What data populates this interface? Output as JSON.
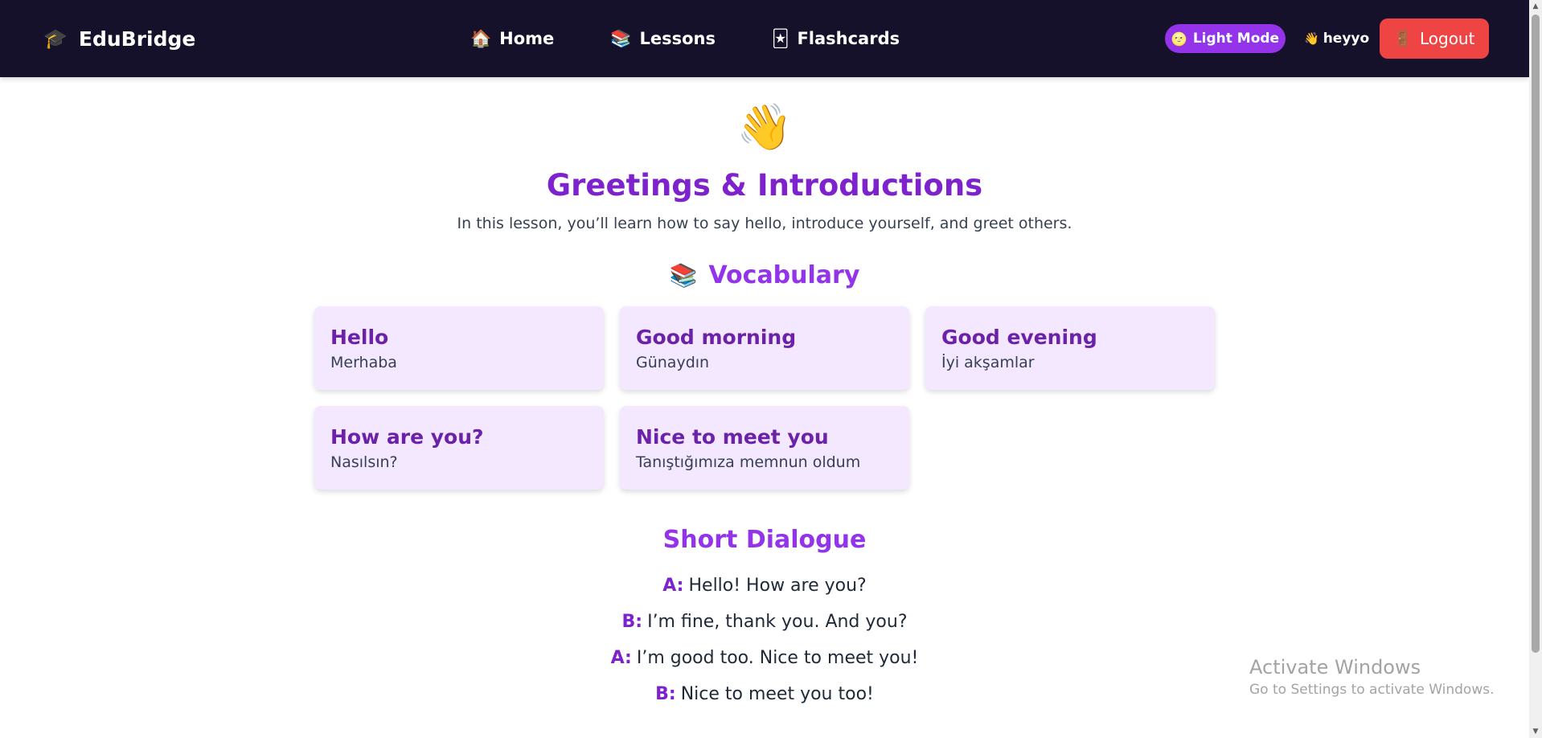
{
  "nav": {
    "brand_icon": "🎓",
    "brand": "EduBridge",
    "links": [
      {
        "icon": "🏠",
        "label": "Home"
      },
      {
        "icon": "📚",
        "label": "Lessons"
      },
      {
        "icon": "🃏",
        "label": "Flashcards"
      }
    ],
    "theme_icon": "🌝",
    "theme_label": "Light Mode",
    "user_icon": "👋",
    "username": "heyyo",
    "logout_icon": "🚪",
    "logout_label": "Logout"
  },
  "lesson": {
    "icon": "👋",
    "title": "Greetings & Introductions",
    "description": "In this lesson, you’ll learn how to say hello, introduce yourself, and greet others."
  },
  "vocabulary": {
    "icon": "📚",
    "heading": "Vocabulary",
    "items": [
      {
        "word": "Hello",
        "translation": "Merhaba"
      },
      {
        "word": "Good morning",
        "translation": "Günaydın"
      },
      {
        "word": "Good evening",
        "translation": "İyi akşamlar"
      },
      {
        "word": "How are you?",
        "translation": "Nasılsın?"
      },
      {
        "word": "Nice to meet you",
        "translation": "Tanıştığımıza memnun oldum"
      }
    ]
  },
  "dialogue": {
    "heading": "Short Dialogue",
    "lines": [
      {
        "speaker": "A:",
        "text": "Hello! How are you?"
      },
      {
        "speaker": "B:",
        "text": "I’m fine, thank you. And you?"
      },
      {
        "speaker": "A:",
        "text": "I’m good too. Nice to meet you!"
      },
      {
        "speaker": "B:",
        "text": "Nice to meet you too!"
      }
    ]
  },
  "watermark": {
    "title": "Activate Windows",
    "subtitle": "Go to Settings to activate Windows."
  },
  "colors": {
    "navbar": "#16112b",
    "accent_purple": "#9333ea",
    "card_bg": "#f3e8ff",
    "logout_red": "#ef4444"
  }
}
